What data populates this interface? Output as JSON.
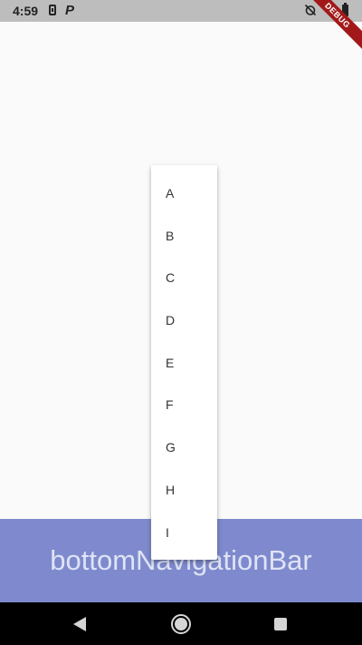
{
  "status_bar": {
    "time": "4:59",
    "notification_letter": "P"
  },
  "debug_banner": {
    "label": "DEBUG"
  },
  "popup_menu": {
    "items": [
      "A",
      "B",
      "C",
      "D",
      "E",
      "F",
      "G",
      "H",
      "I"
    ]
  },
  "bottom_bar": {
    "label": "bottomNavigationBar",
    "color": "#7e8acd"
  },
  "colors": {
    "background": "#fafafa",
    "status_bar": "#bdbdbd",
    "debug_ribbon": "#a31919"
  }
}
